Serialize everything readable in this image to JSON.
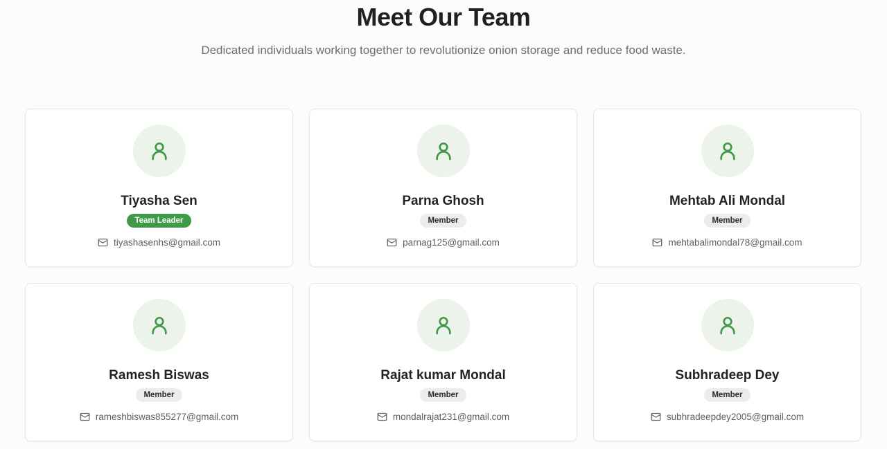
{
  "header": {
    "title": "Meet Our Team",
    "subtitle": "Dedicated individuals working together to revolutionize onion storage and reduce food waste."
  },
  "colors": {
    "accent": "#3f9a48",
    "avatar_bg": "#ecf3ea",
    "badge_bg": "#ececea"
  },
  "team": [
    {
      "name": "Tiyasha Sen",
      "role": "Team Leader",
      "email": "tiyashasenhs@gmail.com"
    },
    {
      "name": "Parna Ghosh",
      "role": "Member",
      "email": "parnag125@gmail.com"
    },
    {
      "name": "Mehtab Ali Mondal",
      "role": "Member",
      "email": "mehtabalimondal78@gmail.com"
    },
    {
      "name": "Ramesh Biswas",
      "role": "Member",
      "email": "rameshbiswas855277@gmail.com"
    },
    {
      "name": "Rajat kumar Mondal",
      "role": "Member",
      "email": "mondalrajat231@gmail.com"
    },
    {
      "name": "Subhradeep Dey",
      "role": "Member",
      "email": "subhradeepdey2005@gmail.com"
    }
  ],
  "icons": {
    "avatar": "user-icon",
    "email": "mail-icon"
  }
}
